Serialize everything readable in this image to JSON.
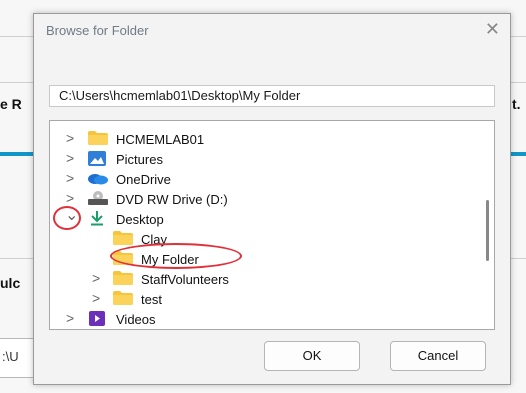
{
  "background": {
    "left_fragments": [
      "e R",
      "ulc"
    ],
    "right_fragment": "t.",
    "field_text": ":\\U"
  },
  "dialog": {
    "title": "Browse for Folder",
    "close_glyph": "✕",
    "path": "C:\\Users\\hcmemlab01\\Desktop\\My Folder",
    "tree": [
      {
        "label": "HCMEMLAB01",
        "icon": "folder-icon",
        "expander": ">"
      },
      {
        "label": "Pictures",
        "icon": "pictures-icon",
        "expander": ">"
      },
      {
        "label": "OneDrive",
        "icon": "cloud-icon",
        "expander": ">"
      },
      {
        "label": "DVD RW Drive (D:)",
        "icon": "dvd-drive-icon",
        "expander": ">"
      },
      {
        "label": "Desktop",
        "icon": "download-arrow-icon",
        "expander": "⌄"
      },
      {
        "label": "Clay",
        "icon": "folder-icon",
        "expander": ""
      },
      {
        "label": "My Folder",
        "icon": "folder-icon",
        "expander": ""
      },
      {
        "label": "StaffVolunteers",
        "icon": "folder-icon",
        "expander": ">"
      },
      {
        "label": "test",
        "icon": "folder-icon",
        "expander": ">"
      },
      {
        "label": "Videos",
        "icon": "videos-icon",
        "expander": ">"
      }
    ],
    "ok_label": "OK",
    "cancel_label": "Cancel"
  },
  "colors": {
    "accent": "#1296c8",
    "folder": "#f7c43e",
    "highlight_circle": "#e0303a"
  }
}
